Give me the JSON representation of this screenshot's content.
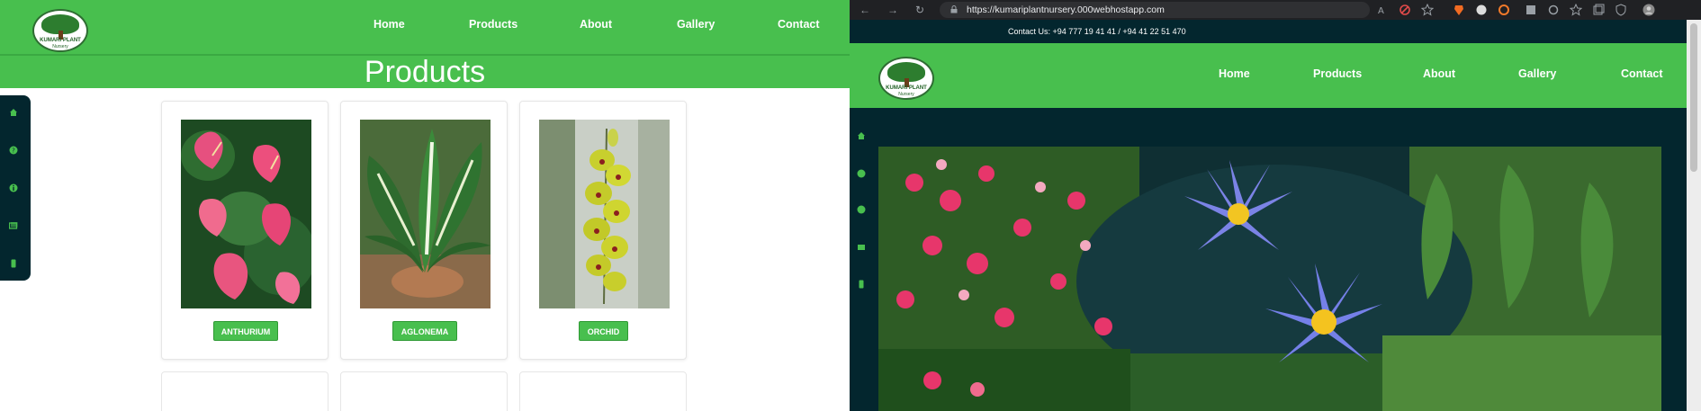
{
  "left_page": {
    "nav": {
      "logo_text": "KUMARI PLANT",
      "logo_sub": "Nursery",
      "links": [
        "Home",
        "Products",
        "About",
        "Gallery",
        "Contact"
      ]
    },
    "page_title": "Products",
    "sidebar_icons": [
      "home-icon",
      "question-icon",
      "info-icon",
      "gallery-icon",
      "contact-icon"
    ],
    "products": [
      {
        "name": "ANTHURIUM"
      },
      {
        "name": "AGLONEMA"
      },
      {
        "name": "ORCHID"
      }
    ]
  },
  "browser": {
    "url": "https://kumariplantnursery.000webhostapp.com"
  },
  "right_page": {
    "contact_bar": "Contact Us: +94 777 19 41 41 / +94 41 22 51 470",
    "nav": {
      "logo_text": "KUMARI PLANT",
      "logo_sub": "Nursery",
      "links": [
        "Home",
        "Products",
        "About",
        "Gallery",
        "Contact"
      ]
    },
    "sidebar_icons": [
      "home-icon",
      "question-icon",
      "info-icon",
      "gallery-icon",
      "contact-icon"
    ]
  },
  "colors": {
    "brand_green": "#48bf4e",
    "dark_teal": "#03262e",
    "button_green": "#48bf4e"
  }
}
